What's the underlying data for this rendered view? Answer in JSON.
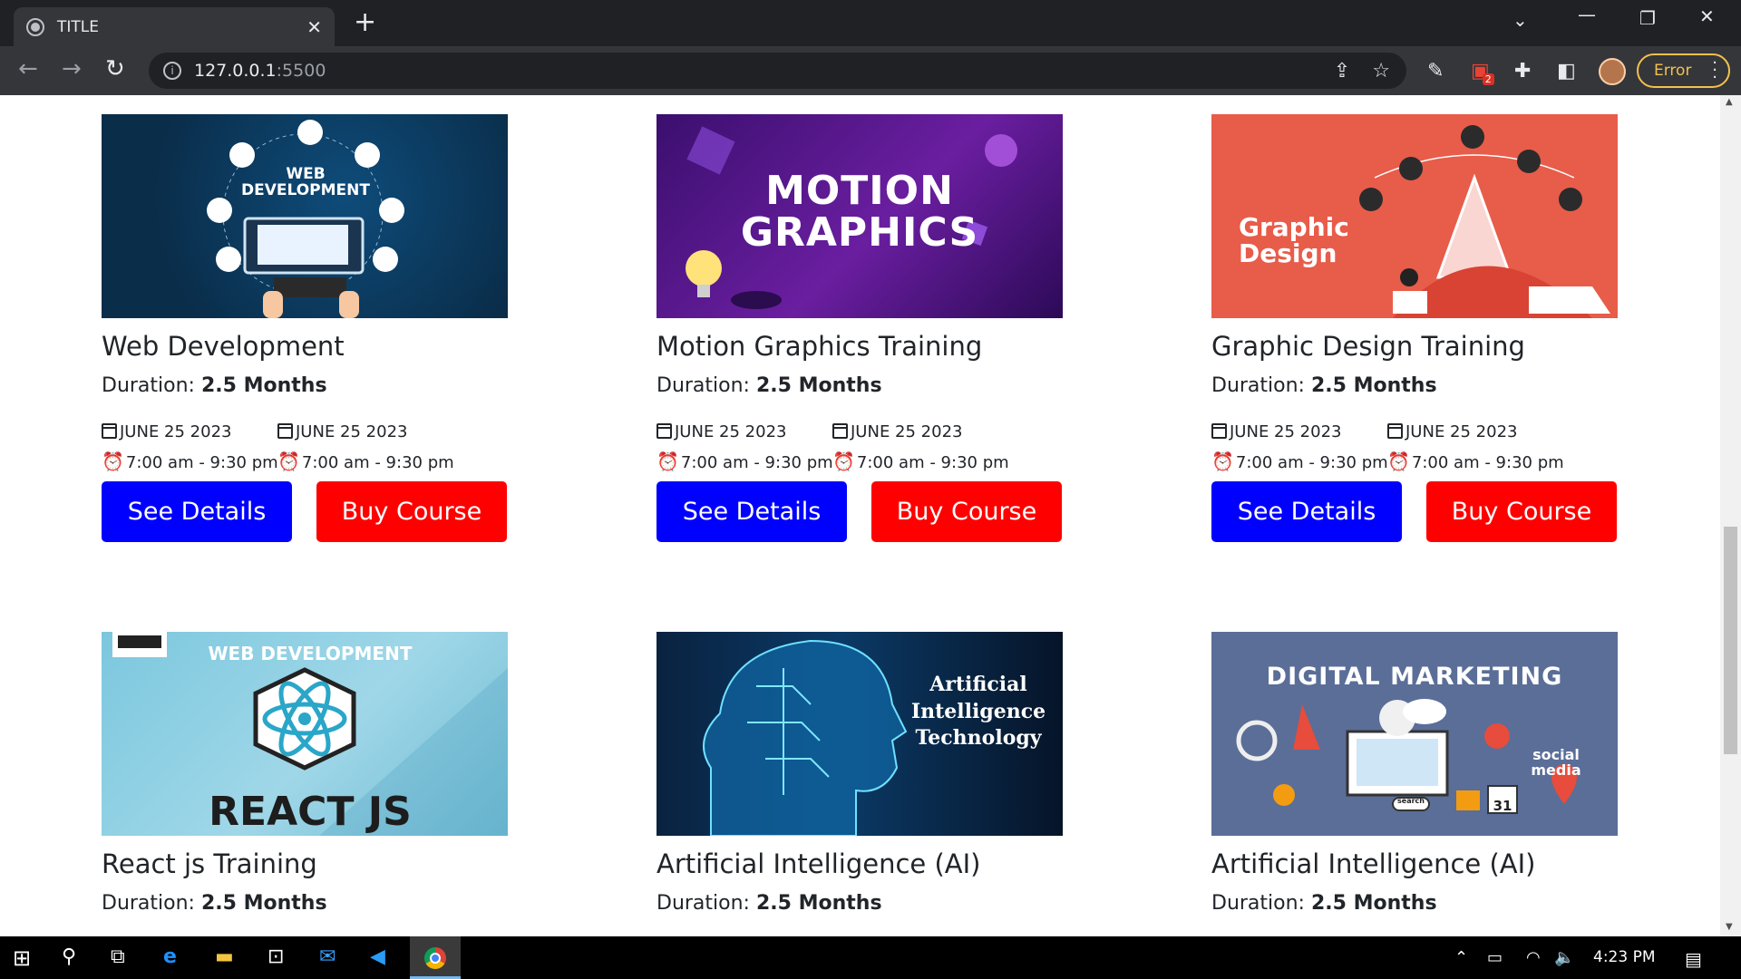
{
  "browser": {
    "tab_title": "TITLE",
    "tab_close": "✕",
    "new_tab": "+",
    "url_host": "127.0.0.1",
    "url_port": ":5500",
    "error_label": "Error",
    "extension_badge": "2"
  },
  "courses": [
    {
      "title": "Web Development",
      "duration_label": "Duration: ",
      "duration_value": "2.5 Months",
      "date1": "JUNE 25 2023",
      "date2": "JUNE 25 2023",
      "time1": "7:00 am - 9:30 pm",
      "time2": "7:00 am - 9:30 pm",
      "details_label": "See Details",
      "buy_label": "Buy Course",
      "image_text": "WEB\nDEVELOPMENT"
    },
    {
      "title": "Motion Graphics Training",
      "duration_label": "Duration: ",
      "duration_value": "2.5 Months",
      "date1": "JUNE 25 2023",
      "date2": "JUNE 25 2023",
      "time1": "7:00 am - 9:30 pm",
      "time2": "7:00 am - 9:30 pm",
      "details_label": "See Details",
      "buy_label": "Buy Course",
      "image_text": "MOTION\nGRAPHICS"
    },
    {
      "title": "Graphic Design Training",
      "duration_label": "Duration: ",
      "duration_value": "2.5 Months",
      "date1": "JUNE 25 2023",
      "date2": "JUNE 25 2023",
      "time1": "7:00 am - 9:30 pm",
      "time2": "7:00 am - 9:30 pm",
      "details_label": "See Details",
      "buy_label": "Buy Course",
      "image_text": "Graphic\nDesign"
    },
    {
      "title": "React js Training",
      "duration_label": "Duration: ",
      "duration_value": "2.5 Months",
      "image_text_top": "WEB DEVELOPMENT",
      "image_text": "REACT JS"
    },
    {
      "title": "Artificial Intelligence (AI)",
      "duration_label": "Duration: ",
      "duration_value": "2.5 Months",
      "image_text": "Artificial\nIntelligence\nTechnology"
    },
    {
      "title": "Artificial Intelligence (AI)",
      "duration_label": "Duration: ",
      "duration_value": "2.5 Months",
      "image_text": "DIGITAL MARKETING",
      "image_text_small": "social\nmedia",
      "image_text_cal": "31",
      "image_text_search": "search"
    }
  ],
  "taskbar": {
    "time": "4:23 PM"
  },
  "colors": {
    "see_details_bg": "#0000ff",
    "buy_course_bg": "#ff0000"
  }
}
